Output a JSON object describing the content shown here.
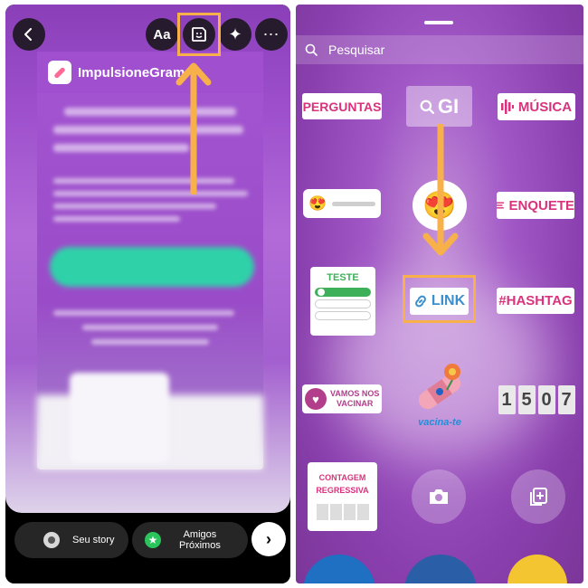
{
  "left_panel": {
    "card_brand": "ImpulsioneGram",
    "text_button_label": "Aa",
    "bottom_bar": {
      "your_story_label": "Seu story",
      "close_friends_line1": "Amigos",
      "close_friends_line2": "Próximos"
    },
    "icons": [
      "back-arrow-icon",
      "sticker-icon",
      "effects-sparkle-icon",
      "more-options-icon",
      "next-arrow-icon"
    ]
  },
  "right_panel": {
    "search_placeholder": "Pesquisar",
    "stickers": {
      "perguntas": "PERGUNTAS",
      "gif": "GI",
      "musica": "MÚSICA",
      "enquete": "ENQUETE",
      "teste": "TESTE",
      "link": "LINK",
      "hashtag": "#HASHTAG",
      "vacinar_line1": "VAMOS NOS",
      "vacinar_line2": "VACINAR",
      "vacinate": "vacina-te",
      "clock_digits": [
        "1",
        "5",
        "0",
        "7"
      ],
      "contagem_line1": "CONTAGEM",
      "contagem_line2": "REGRESSIVA"
    }
  },
  "annotations": {
    "highlight_color": "#f7b04a"
  },
  "colors": {
    "accent_pink": "#d8337c",
    "link_blue": "#3b8fcf",
    "green": "#29c45b"
  }
}
